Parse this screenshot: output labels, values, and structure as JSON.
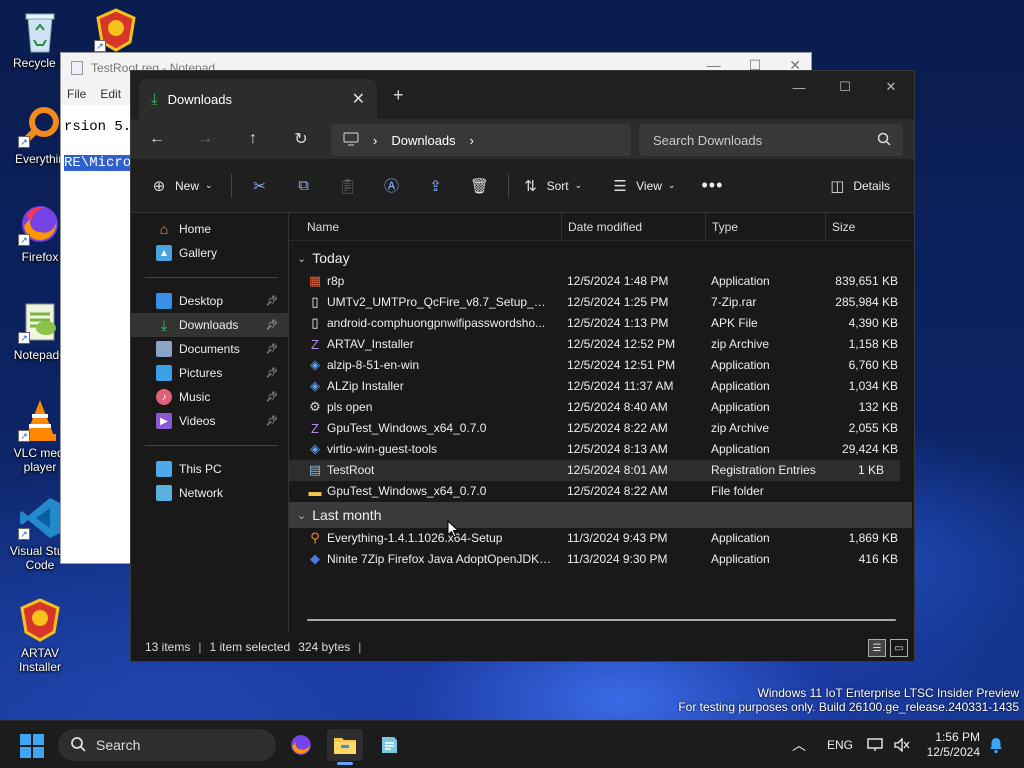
{
  "desktop": {
    "icons": [
      {
        "label": "Recycle Bin",
        "shown": "Recycle B"
      },
      {
        "label": "Everything",
        "shown": "Everythin"
      },
      {
        "label": "Firefox",
        "shown": "Firefox"
      },
      {
        "label": "Notepad++",
        "shown": "Notepad+"
      },
      {
        "label": "VLC media player",
        "shown": "VLC medi player"
      },
      {
        "label": "Visual Studio Code",
        "shown": "Visual Stud Code"
      },
      {
        "label": "ARTAV Installer",
        "shown": "ARTAV Installer"
      }
    ]
  },
  "notepad": {
    "title": "TestRoot.reg - Notepad",
    "menu": [
      "File",
      "Edit"
    ],
    "line1": "rsion 5.0",
    "line2": "RE\\Micros"
  },
  "explorer": {
    "tab_title": "Downloads",
    "address": {
      "segment": "Downloads"
    },
    "search_placeholder": "Search Downloads",
    "commands": {
      "new": "New",
      "sort": "Sort",
      "view": "View",
      "details": "Details"
    },
    "nav": {
      "home": "Home",
      "gallery": "Gallery",
      "desktop": "Desktop",
      "downloads": "Downloads",
      "documents": "Documents",
      "pictures": "Pictures",
      "music": "Music",
      "videos": "Videos",
      "this_pc": "This PC",
      "network": "Network"
    },
    "columns": {
      "name": "Name",
      "date": "Date modified",
      "type": "Type",
      "size": "Size"
    },
    "groups": [
      {
        "label": "Today",
        "files": [
          {
            "name": "r8p",
            "date": "12/5/2024 1:48 PM",
            "type": "Application",
            "size": "839,651 KB",
            "icon": "app-icon"
          },
          {
            "name": "UMTv2_UMTPro_QcFire_v8.7_Setup_Repa...",
            "date": "12/5/2024 1:25 PM",
            "type": "7-Zip.rar",
            "size": "285,984 KB",
            "icon": "file-icon"
          },
          {
            "name": "android-comphuongpnwifipasswordsho...",
            "date": "12/5/2024 1:13 PM",
            "type": "APK File",
            "size": "4,390 KB",
            "icon": "file-icon"
          },
          {
            "name": "ARTAV_Installer",
            "date": "12/5/2024 12:52 PM",
            "type": "zip Archive",
            "size": "1,158 KB",
            "icon": "zip-icon"
          },
          {
            "name": "alzip-8-51-en-win",
            "date": "12/5/2024 12:51 PM",
            "type": "Application",
            "size": "6,760 KB",
            "icon": "installer-icon"
          },
          {
            "name": "ALZip Installer",
            "date": "12/5/2024 11:37 AM",
            "type": "Application",
            "size": "1,034 KB",
            "icon": "installer-icon"
          },
          {
            "name": "pls open",
            "date": "12/5/2024 8:40 AM",
            "type": "Application",
            "size": "132 KB",
            "icon": "gear-icon"
          },
          {
            "name": "GpuTest_Windows_x64_0.7.0",
            "date": "12/5/2024 8:22 AM",
            "type": "zip Archive",
            "size": "2,055 KB",
            "icon": "zip-icon"
          },
          {
            "name": "virtio-win-guest-tools",
            "date": "12/5/2024 8:13 AM",
            "type": "Application",
            "size": "29,424 KB",
            "icon": "installer-icon"
          },
          {
            "name": "TestRoot",
            "date": "12/5/2024 8:01 AM",
            "type": "Registration Entries",
            "size": "1 KB",
            "icon": "reg-icon",
            "selected": true
          },
          {
            "name": "GpuTest_Windows_x64_0.7.0",
            "date": "12/5/2024 8:22 AM",
            "type": "File folder",
            "size": "",
            "icon": "folder-icon"
          }
        ]
      },
      {
        "label": "Last month",
        "files": [
          {
            "name": "Everything-1.4.1.1026.x64-Setup",
            "date": "11/3/2024 9:43 PM",
            "type": "Application",
            "size": "1,869 KB",
            "icon": "search-app-icon"
          },
          {
            "name": "Ninite 7Zip Firefox Java AdoptOpenJDK x...",
            "date": "11/3/2024 9:30 PM",
            "type": "Application",
            "size": "416 KB",
            "icon": "ninite-icon"
          }
        ]
      }
    ],
    "status": {
      "items": "13 items",
      "selected": "1 item selected",
      "bytes": "324 bytes"
    }
  },
  "watermark": {
    "line1": "Windows 11 IoT Enterprise LTSC Insider Preview",
    "line2": "For testing purposes only. Build 26100.ge_release.240331-1435"
  },
  "taskbar": {
    "search_label": "Search",
    "language": "ENG",
    "time": "1:56 PM",
    "date": "12/5/2024"
  },
  "colors": {
    "accent": "#60a5fa",
    "folder": "#f5c84c",
    "window_bg": "#191919"
  }
}
